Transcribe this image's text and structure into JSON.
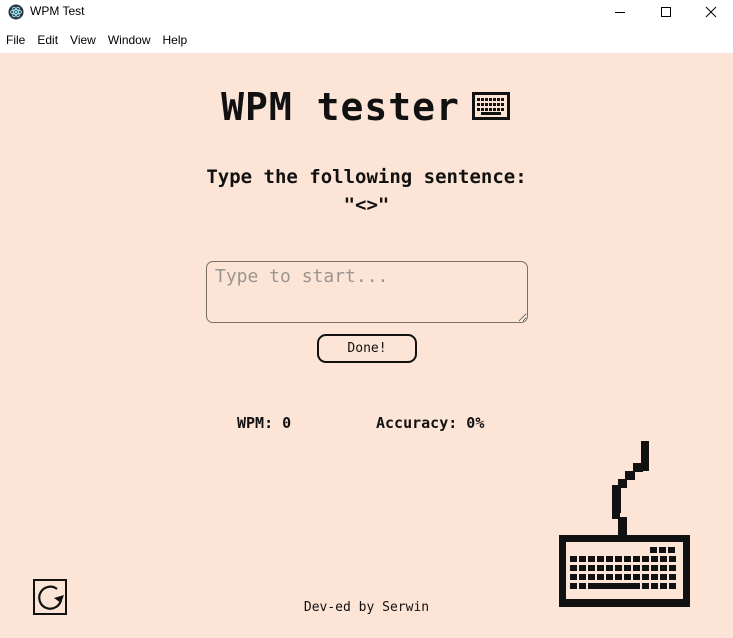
{
  "window": {
    "title": "WPM Test",
    "app_icon": "electron-icon",
    "controls": [
      "minimize-icon",
      "maximize-icon",
      "close-icon"
    ]
  },
  "menu": [
    "File",
    "Edit",
    "View",
    "Window",
    "Help"
  ],
  "main": {
    "heading": "WPM tester",
    "heading_icon": "keyboard-icon",
    "prompt_label": "Type the following sentence:",
    "sentence": "\"<>\"",
    "input_placeholder": "Type to start...",
    "input_value": "",
    "done_label": "Done!",
    "wpm_text": "WPM: 0",
    "accuracy_text": "Accuracy: 0%",
    "footer": "Dev-ed by Serwin"
  },
  "colors": {
    "background": "#fce5d6",
    "text": "#111111"
  },
  "icons": {
    "restart": "restart-icon",
    "illustration": "keyboard-illustration"
  }
}
